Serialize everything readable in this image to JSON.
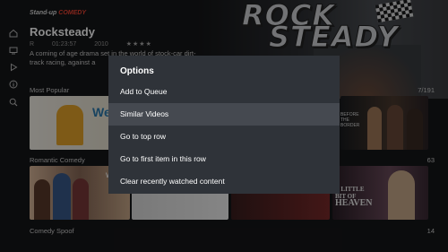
{
  "brand": {
    "part1": "Stand-up",
    "part2": "COMEDY"
  },
  "hero": {
    "line1": "ROCK",
    "line2": "STEADY"
  },
  "sidebar": {
    "icons": [
      "home-icon",
      "tv-icon",
      "play-icon",
      "info-icon",
      "search-icon"
    ]
  },
  "title": "Rocksteady",
  "meta": {
    "rating": "R",
    "duration": "01:23:57",
    "year": "2010",
    "stars": "★★★★"
  },
  "description": "A coming of age drama set in the world of stock-car dirt-track racing, against a",
  "rows": [
    {
      "label": "Most Popular",
      "count": "7/191"
    },
    {
      "label": "Romantic Comedy",
      "count": "63"
    },
    {
      "label": "Comedy Spoof",
      "count": "14"
    }
  ],
  "tiles": {
    "weather": "Weath",
    "before": "BEFORE THE BORDER",
    "heaven1": "A LITTLE",
    "heaven2": "BIT OF",
    "heaven3": "HEAVEN",
    "wonder": "wonde"
  },
  "dialog": {
    "title": "Options",
    "options": [
      "Add to Queue",
      "Similar Videos",
      "Go to top row",
      "Go to first item in this row",
      "Clear recently watched content"
    ],
    "selected_index": 1
  },
  "colors": {
    "background": "#151618",
    "dialog": "#2f3339",
    "selected": "#454950",
    "brand_accent": "#e43"
  }
}
